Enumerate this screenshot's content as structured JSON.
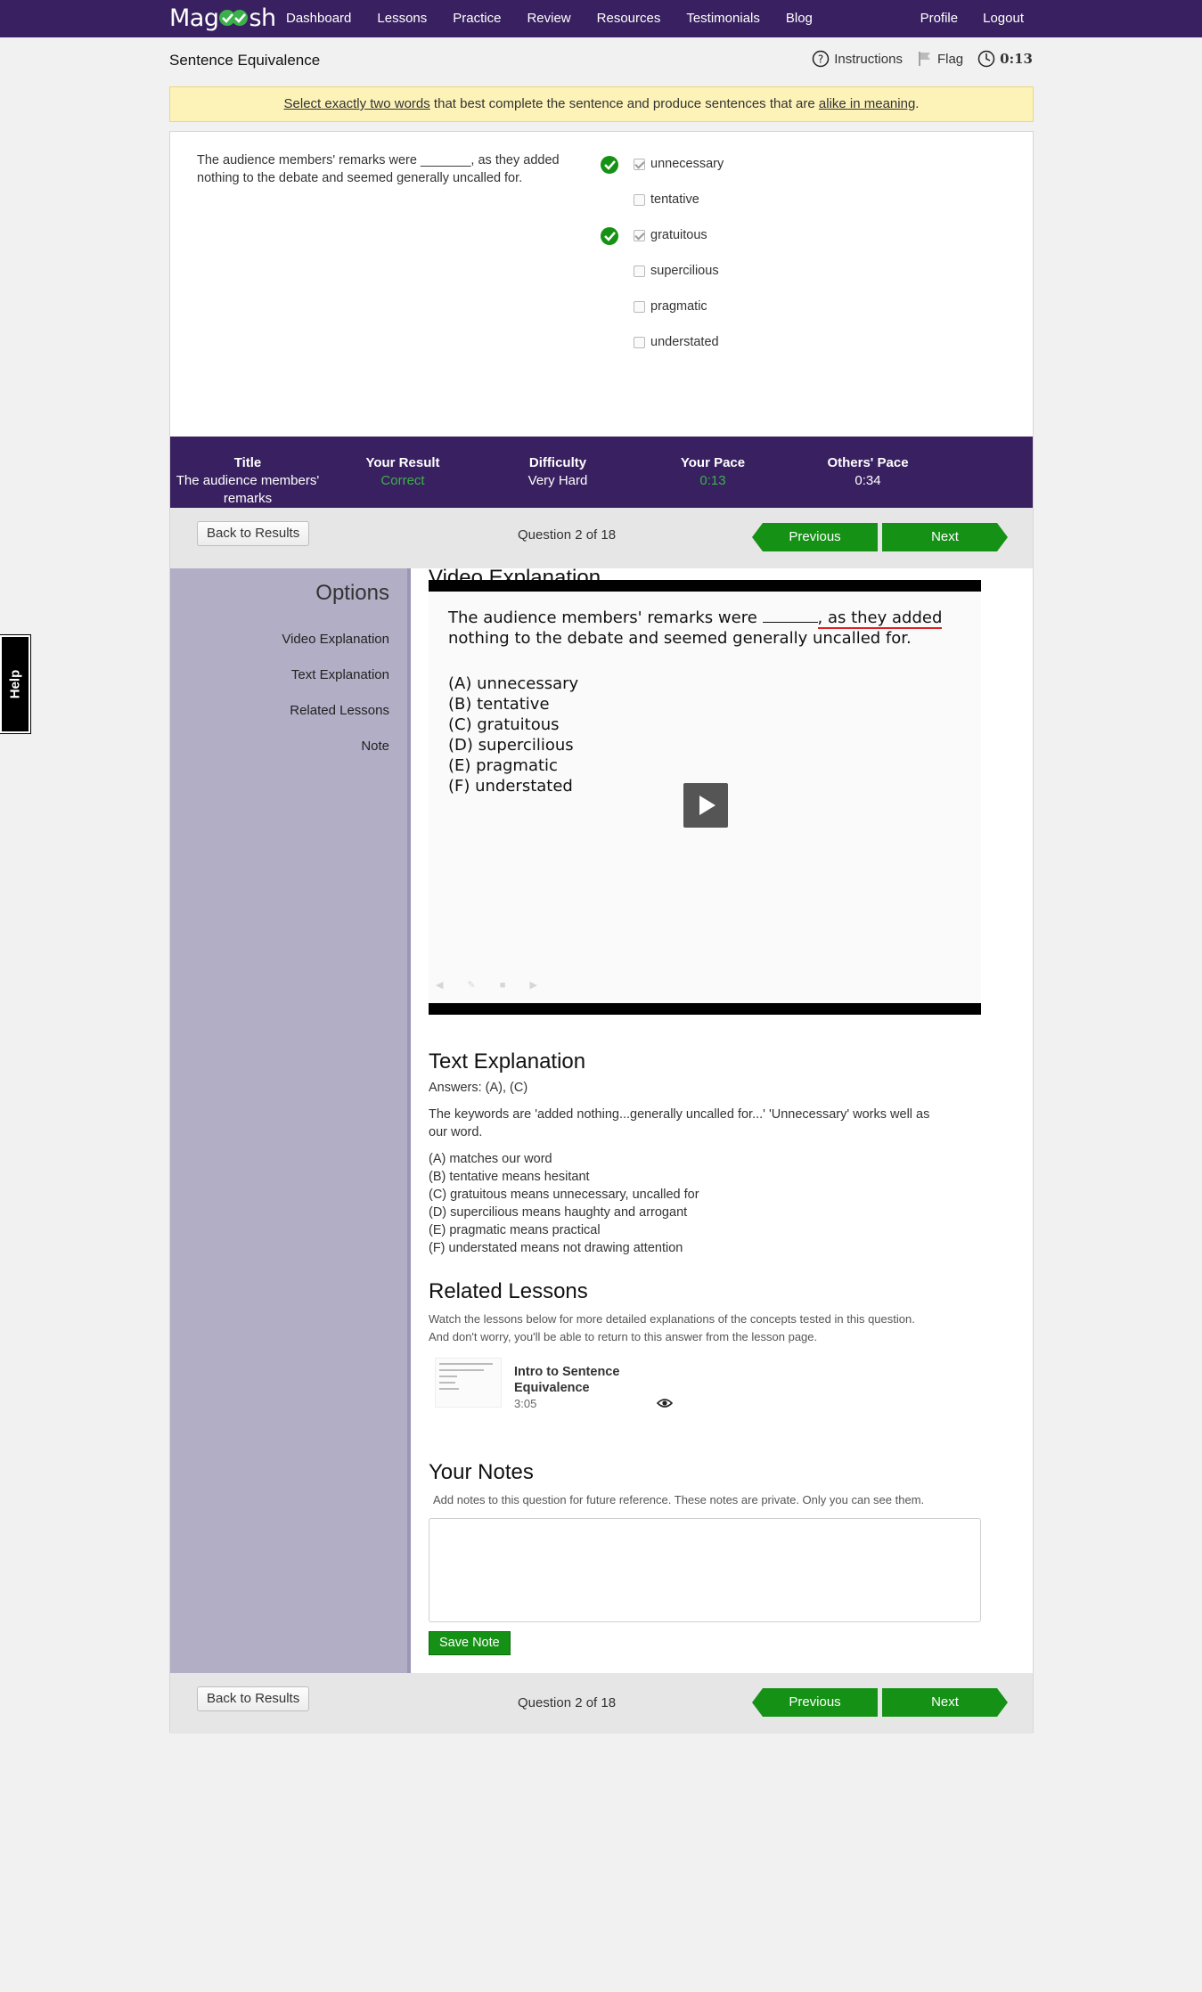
{
  "nav": {
    "logo": "Magoosh",
    "items": [
      "Dashboard",
      "Lessons",
      "Practice",
      "Review",
      "Resources",
      "Testimonials",
      "Blog"
    ],
    "right": [
      "Profile",
      "Logout"
    ]
  },
  "header": {
    "question_type": "Sentence Equivalence",
    "instructions": "Instructions",
    "flag": "Flag",
    "timer": "0:13"
  },
  "instruction_banner": {
    "part1": "Select exactly two words",
    "part2": " that best complete the sentence and produce sentences that are ",
    "part3": "alike in meaning",
    "part4": "."
  },
  "question": {
    "stem_line1": "The audience members' remarks were _______, as they added",
    "stem_line2": "nothing to the debate and seemed generally uncalled for.",
    "choices": [
      {
        "label": "unnecessary",
        "checked": true,
        "correct": true
      },
      {
        "label": "tentative",
        "checked": false,
        "correct": false
      },
      {
        "label": "gratuitous",
        "checked": true,
        "correct": true
      },
      {
        "label": "supercilious",
        "checked": false,
        "correct": false
      },
      {
        "label": "pragmatic",
        "checked": false,
        "correct": false
      },
      {
        "label": "understated",
        "checked": false,
        "correct": false
      }
    ]
  },
  "summary": {
    "title_h": "Title",
    "title_v1": "The audience members'",
    "title_v2": "remarks",
    "result_h": "Your Result",
    "result_v": "Correct",
    "difficulty_h": "Difficulty",
    "difficulty_v": "Very Hard",
    "pace_h": "Your Pace",
    "pace_v": "0:13",
    "others_h": "Others' Pace",
    "others_v": "0:34",
    "green": "#3bb14a"
  },
  "pager": {
    "back": "Back to Results",
    "count": "Question 2 of 18",
    "previous": "Previous",
    "next": "Next"
  },
  "sidebar": {
    "title": "Options",
    "items": [
      "Video Explanation",
      "Text Explanation",
      "Related Lessons",
      "Note"
    ]
  },
  "video": {
    "heading": "Video Explanation",
    "q_part1": "The audience members' remarks were ",
    "q_part2": ", as they added",
    "q_line2": "nothing to the debate and seemed generally uncalled for.",
    "options": [
      "(A) unnecessary",
      "(B) tentative",
      "(C) gratuitous",
      "(D) supercilious",
      "(E) pragmatic",
      "(F) understated"
    ]
  },
  "text_explanation": {
    "heading": "Text Explanation",
    "answers": "Answers: (A), (C)",
    "para1": "The keywords are 'added nothing...generally uncalled for...' 'Unnecessary' works well as",
    "para2": "our word.",
    "lines": [
      "(A) matches our word",
      "(B) tentative means hesitant",
      "(C) gratuitous means unnecessary, uncalled for",
      "(D) supercilious means haughty and arrogant",
      "(E) pragmatic means practical",
      "(F) understated means not drawing attention"
    ]
  },
  "related": {
    "heading": "Related Lessons",
    "desc1": "Watch the lessons below for more detailed explanations of the concepts tested in this question.",
    "desc2": "And don't worry, you'll be able to return to this answer from the lesson page.",
    "lesson_title1": "Intro to Sentence",
    "lesson_title2": "Equivalence",
    "lesson_duration": "3:05"
  },
  "notes": {
    "heading": "Your Notes",
    "desc": "Add notes to this question for future reference. These notes are private. Only you can see them.",
    "value": "",
    "save": "Save Note"
  },
  "help": "Help",
  "colors": {
    "brand_purple": "#392060",
    "accent_green": "#159215"
  }
}
